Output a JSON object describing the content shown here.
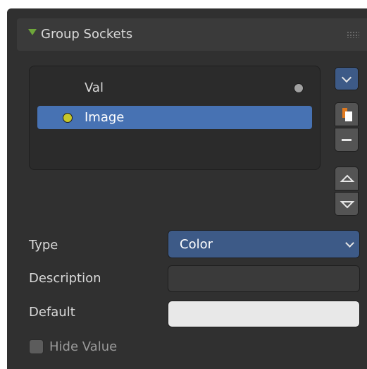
{
  "panel": {
    "title": "Group Sockets",
    "header_arrow_color": "#6ea63a"
  },
  "sockets": {
    "items": [
      {
        "label": "Val",
        "socket_color": "#a1a1a1",
        "selected": false
      },
      {
        "label": "Image",
        "socket_color": "#c7c729",
        "selected": true
      }
    ],
    "selection_color": "#4772b3"
  },
  "side_buttons": {
    "dropdown_icon": "chevron-down-icon",
    "add_icon": "add-icon",
    "remove_icon": "minus-icon",
    "move_up_icon": "triangle-up-icon",
    "move_down_icon": "triangle-down-icon"
  },
  "properties": {
    "type": {
      "label": "Type",
      "value": "Color"
    },
    "description": {
      "label": "Description",
      "value": ""
    },
    "default": {
      "label": "Default",
      "color": "#e8e8e8"
    },
    "hide_value": {
      "label": "Hide Value",
      "checked": false
    }
  }
}
